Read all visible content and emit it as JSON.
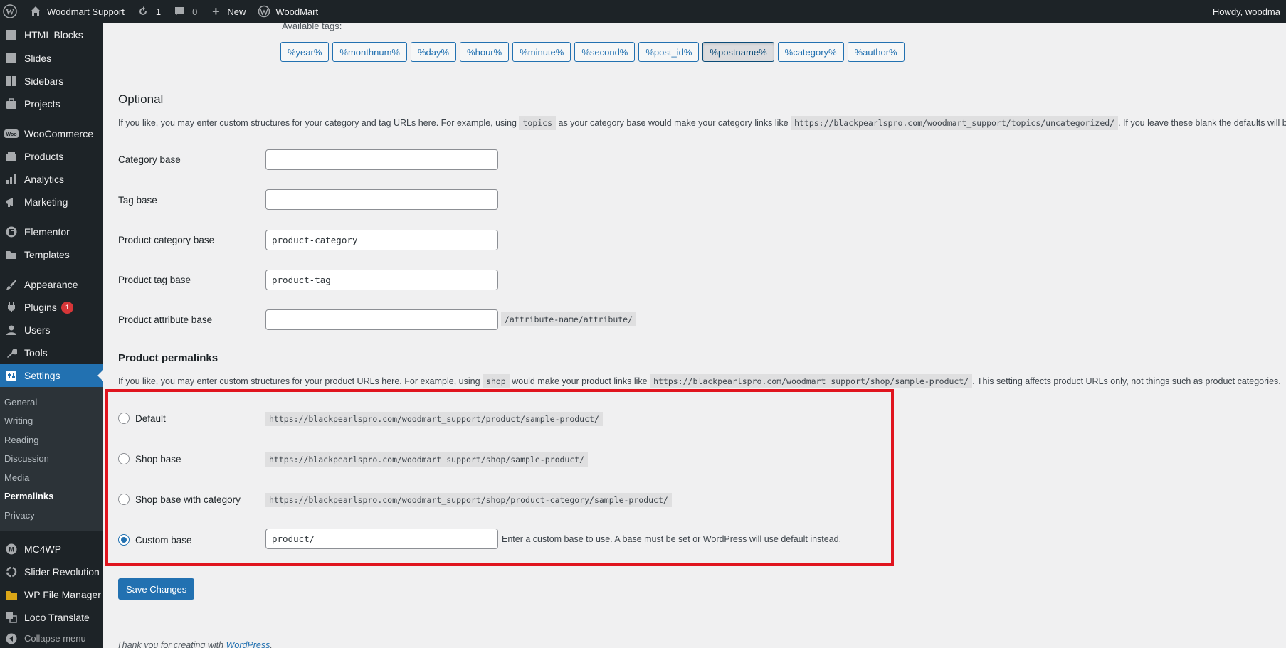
{
  "adminbar": {
    "site_name": "Woodmart Support",
    "updates_count": "1",
    "comments_count": "0",
    "new_label": "New",
    "woodmart_label": "WoodMart",
    "howdy": "Howdy, woodma"
  },
  "sidebar": {
    "items": [
      {
        "label": "HTML Blocks",
        "icon": "blocks-icon"
      },
      {
        "label": "Slides",
        "icon": "slides-icon"
      },
      {
        "label": "Sidebars",
        "icon": "sidebars-icon"
      },
      {
        "label": "Projects",
        "icon": "portfolio-icon"
      },
      {
        "label": "WooCommerce",
        "icon": "woocommerce-icon"
      },
      {
        "label": "Products",
        "icon": "products-icon"
      },
      {
        "label": "Analytics",
        "icon": "analytics-icon"
      },
      {
        "label": "Marketing",
        "icon": "megaphone-icon"
      },
      {
        "label": "Elementor",
        "icon": "elementor-icon"
      },
      {
        "label": "Templates",
        "icon": "folder-icon"
      },
      {
        "label": "Appearance",
        "icon": "paintbrush-icon"
      },
      {
        "label": "Plugins",
        "icon": "plugins-icon",
        "badge": "1"
      },
      {
        "label": "Users",
        "icon": "users-icon"
      },
      {
        "label": "Tools",
        "icon": "wrench-icon"
      },
      {
        "label": "Settings",
        "icon": "settings-icon"
      }
    ],
    "submenu": [
      "General",
      "Writing",
      "Reading",
      "Discussion",
      "Media",
      "Permalinks",
      "Privacy"
    ],
    "bottom_items": [
      {
        "label": "MC4WP",
        "icon": "mc4wp-icon"
      },
      {
        "label": "Slider Revolution",
        "icon": "slider-revolution-icon"
      },
      {
        "label": "WP File Manager",
        "icon": "file-manager-icon"
      },
      {
        "label": "Loco Translate",
        "icon": "translate-icon"
      },
      {
        "label": "Collapse menu",
        "icon": "collapse-icon"
      }
    ]
  },
  "tags": {
    "label": "Available tags:",
    "items": [
      "%year%",
      "%monthnum%",
      "%day%",
      "%hour%",
      "%minute%",
      "%second%",
      "%post_id%",
      "%postname%",
      "%category%",
      "%author%"
    ],
    "active": "%postname%"
  },
  "optional": {
    "title": "Optional",
    "desc_part1": "If you like, you may enter custom structures for your category and tag URLs here. For example, using",
    "desc_code1": "topics",
    "desc_part2": "as your category base would make your category links like",
    "desc_code2": "https://blackpearlspro.com/woodmart_support/topics/uncategorized/",
    "desc_part3": ". If you leave these blank the defaults will be used.",
    "fields": [
      {
        "label": "Category base",
        "value": ""
      },
      {
        "label": "Tag base",
        "value": ""
      },
      {
        "label": "Product category base",
        "value": "product-category"
      },
      {
        "label": "Product tag base",
        "value": "product-tag"
      },
      {
        "label": "Product attribute base",
        "value": "",
        "suffix": "/attribute-name/attribute/"
      }
    ]
  },
  "product_permalinks": {
    "title": "Product permalinks",
    "desc_part1": "If you like, you may enter custom structures for your product URLs here. For example, using",
    "desc_code1": "shop",
    "desc_part2": "would make your product links like",
    "desc_code2": "https://blackpearlspro.com/woodmart_support/shop/sample-product/",
    "desc_part3": ". This setting affects product URLs only, not things such as product categories.",
    "options": [
      {
        "label": "Default",
        "code": "https://blackpearlspro.com/woodmart_support/product/sample-product/"
      },
      {
        "label": "Shop base",
        "code": "https://blackpearlspro.com/woodmart_support/shop/sample-product/"
      },
      {
        "label": "Shop base with category",
        "code": "https://blackpearlspro.com/woodmart_support/shop/product-category/sample-product/"
      },
      {
        "label": "Custom base",
        "value": "product/",
        "desc": "Enter a custom base to use. A base must be set or WordPress will use default instead."
      }
    ],
    "selected": "Custom base"
  },
  "save_label": "Save Changes",
  "footer": {
    "text": "Thank you for creating with",
    "link": "WordPress",
    "period": "."
  }
}
